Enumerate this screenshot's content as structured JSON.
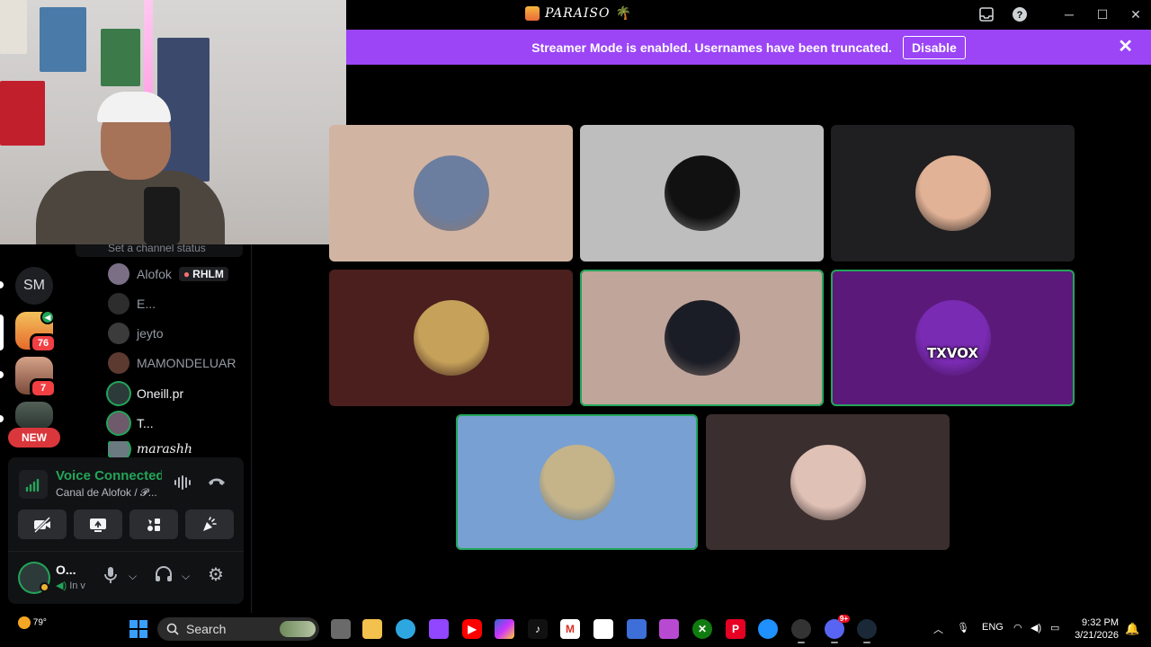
{
  "window": {
    "title": "PARAISO",
    "title_emoji": "🌴"
  },
  "banner": {
    "message": "Streamer Mode is enabled. Usernames have been truncated.",
    "disable_label": "Disable",
    "close_icon": "close-icon"
  },
  "guilds": [
    {
      "label": "SM"
    },
    {
      "badge": "76"
    },
    {
      "badge": "7"
    }
  ],
  "new_label": "NEW",
  "channel_status": "Set a channel status",
  "members": [
    {
      "name": "Alofok",
      "tag": "RHLM"
    },
    {
      "name": "E..."
    },
    {
      "name": "jeyto"
    },
    {
      "name": "MAMONDELUAR"
    },
    {
      "name": "Oneill.pr"
    },
    {
      "name": "T..."
    },
    {
      "name": "marashh"
    }
  ],
  "voice": {
    "title": "Voice Connected",
    "subtitle": "Canal de Alofok / 𝓟..."
  },
  "user": {
    "name": "O...",
    "sub": "In v"
  },
  "tiles": [
    {
      "name": "tile-1",
      "bg": "#d2b4a3",
      "av": "#6c7ea0"
    },
    {
      "name": "tile-2",
      "bg": "#bebebe",
      "av": "#111111"
    },
    {
      "name": "tile-3",
      "bg": "#1f1f21",
      "av": "#e2b296"
    },
    {
      "name": "tile-4",
      "bg": "#4a1f1e",
      "av": "#c6a15a"
    },
    {
      "name": "tile-5",
      "bg": "#c0a59b",
      "av": "#1b1d26"
    },
    {
      "name": "tile-6",
      "bg": "#5b1a7a",
      "av": "#7a2bb3",
      "overlay": "TXVOX"
    },
    {
      "name": "tile-7",
      "bg": "#78a0d2",
      "av": "#c5b48a"
    },
    {
      "name": "tile-8",
      "bg": "#3b2e2e",
      "av": "#e0c1b6"
    }
  ],
  "taskbar": {
    "weather": "79°",
    "search_label": "Search",
    "lang": "ENG",
    "time": "9:32 PM",
    "date": "3/21/2026",
    "discord_badge": "9+"
  }
}
